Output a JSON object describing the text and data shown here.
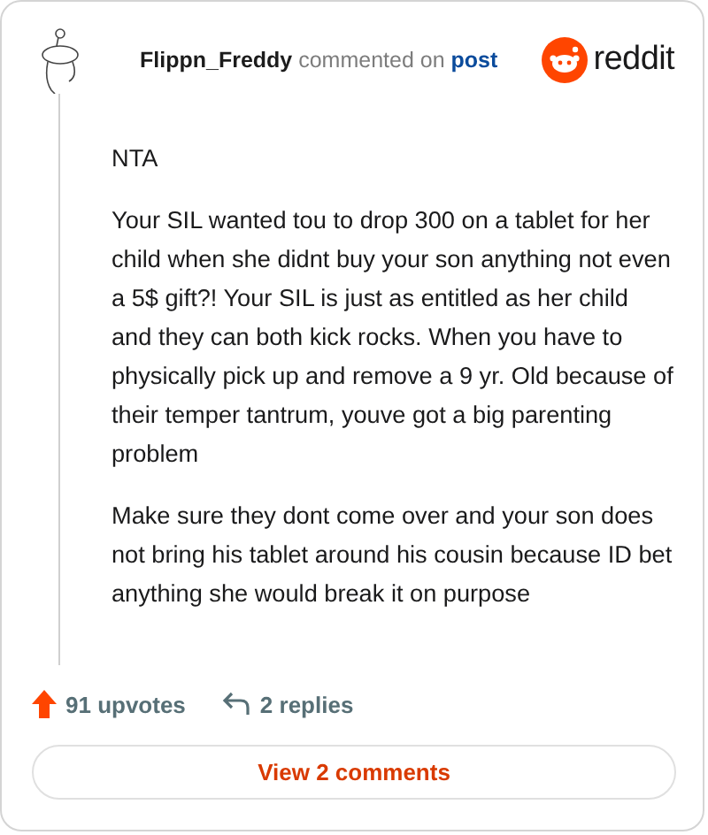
{
  "header": {
    "username": "Flippn_Freddy",
    "action": "commented on",
    "link": "post",
    "logo_text": "reddit"
  },
  "comment": {
    "paragraphs": [
      "NTA",
      "Your SIL wanted tou to drop 300 on a tablet for her child when she didnt buy your son anything not even a 5$ gift?! Your SIL is just as entitled as her child and they can both kick rocks. When you have to physically pick up and remove a 9 yr. Old because of their temper tantrum, youve got a big parenting problem",
      "Make sure they dont come over and your son does not bring his tablet around his cousin because ID bet anything she would break it on purpose"
    ]
  },
  "footer": {
    "upvotes": "91 upvotes",
    "upvoted": true,
    "replies": "2 replies"
  },
  "button": {
    "label": "View 2 comments"
  }
}
